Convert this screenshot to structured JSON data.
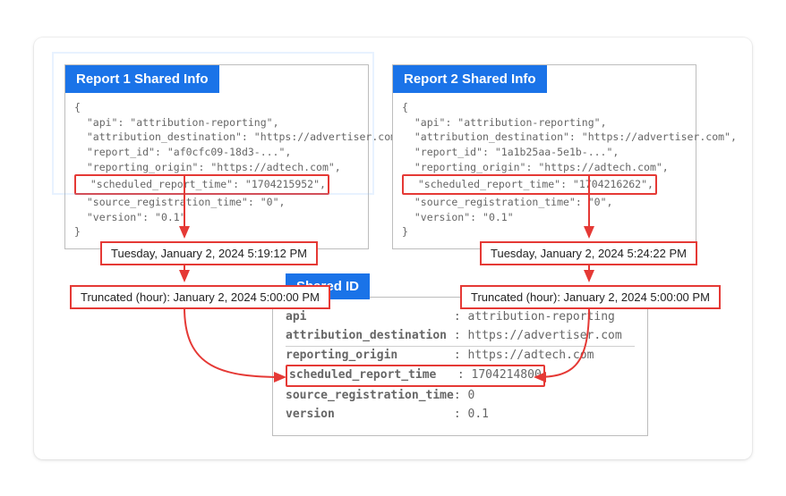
{
  "report1": {
    "header": "Report 1 Shared Info",
    "json": {
      "api": "attribution-reporting",
      "attribution_destination": "https://advertiser.com",
      "report_id": "af0cfc09-18d3-...",
      "reporting_origin": "https://adtech.com",
      "scheduled_report_time": "1704215952",
      "source_registration_time": "0",
      "version": "0.1"
    },
    "human_time": "Tuesday, January 2, 2024 5:19:12 PM",
    "truncated": "Truncated (hour): January 2, 2024 5:00:00 PM"
  },
  "report2": {
    "header": "Report 2 Shared Info",
    "json": {
      "api": "attribution-reporting",
      "attribution_destination": "https://advertiser.com",
      "report_id": "1a1b25aa-5e1b-...",
      "reporting_origin": "https://adtech.com",
      "scheduled_report_time": "1704216262",
      "source_registration_time": "0",
      "version": "0.1"
    },
    "human_time": "Tuesday, January 2, 2024 5:24:22 PM",
    "truncated": "Truncated (hour): January 2, 2024 5:00:00 PM"
  },
  "shared": {
    "header": "Shared ID",
    "rows": {
      "api": {
        "label": "api",
        "value": "attribution-reporting"
      },
      "attribution_destination": {
        "label": "attribution_destination",
        "value": "https://advertiser.com"
      },
      "reporting_origin": {
        "label": "reporting_origin",
        "value": "https://adtech.com"
      },
      "scheduled_report_time": {
        "label": "scheduled_report_time",
        "value": "1704214800"
      },
      "source_registration_time": {
        "label": "source_registration_time",
        "value": "0"
      },
      "version": {
        "label": "version",
        "value": "0.1"
      }
    }
  }
}
